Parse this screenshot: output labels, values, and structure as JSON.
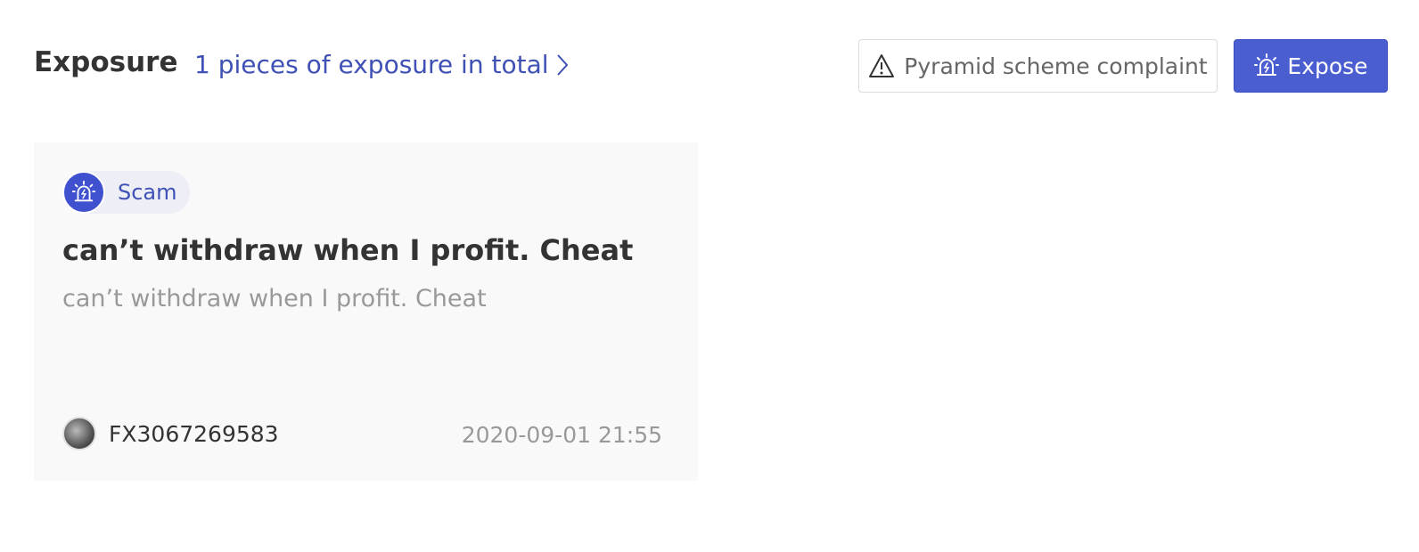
{
  "header": {
    "title": "Exposure",
    "count_link": "1 pieces of exposure in total",
    "complaint_button": "Pyramid scheme complaint",
    "expose_button": "Expose"
  },
  "card": {
    "tag": "Scam",
    "title": " can’t withdraw when I profit. Cheat",
    "description": "can’t withdraw when I profit. Cheat",
    "author": "FX3067269583",
    "date": "2020-09-01 21:55"
  },
  "colors": {
    "accent": "#3f51b5",
    "primary_button": "#4a5ed0",
    "card_bg": "#f9f9f9"
  },
  "icons": {
    "chevron": "chevron-right-icon",
    "warning": "warning-triangle-icon",
    "alarm": "alarm-siren-icon"
  }
}
